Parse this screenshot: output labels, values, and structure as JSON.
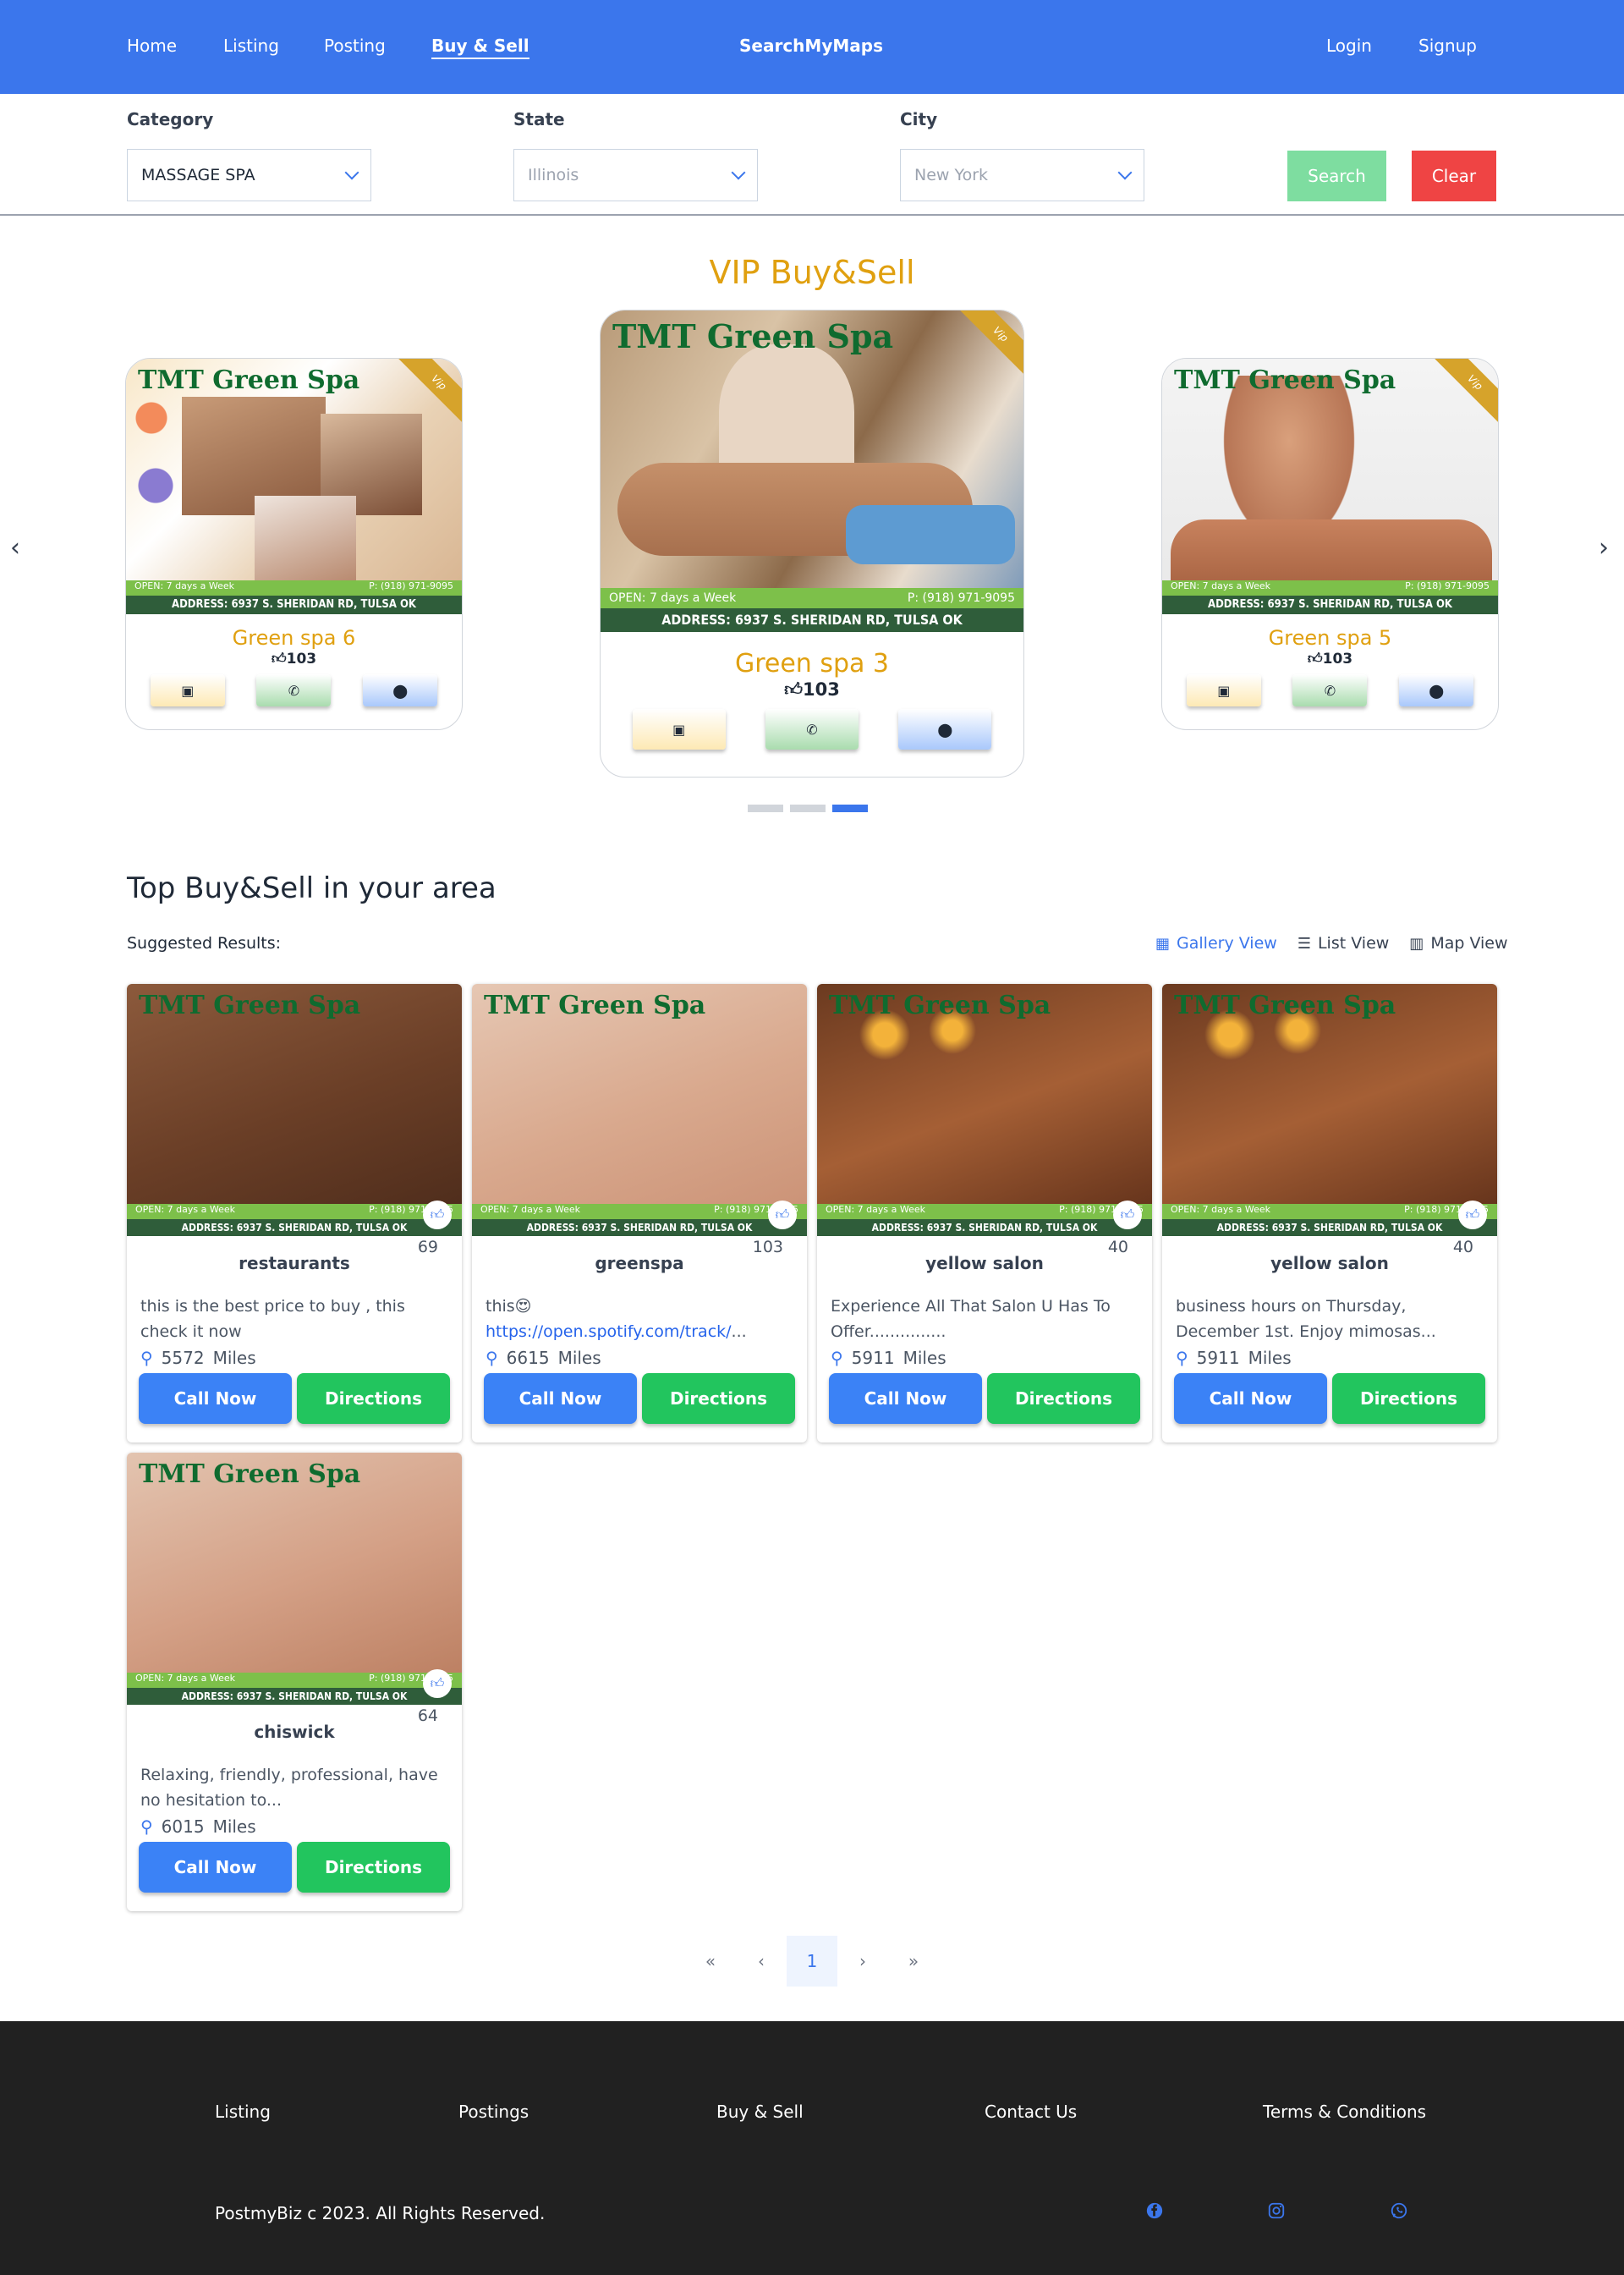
{
  "nav": {
    "links": [
      "Home",
      "Listing",
      "Posting",
      "Buy & Sell"
    ],
    "brand": "SearchMyMaps",
    "login": "Login",
    "signup": "Signup"
  },
  "filters": {
    "category_label": "Category",
    "category_value": "MASSAGE SPA",
    "state_label": "State",
    "state_value": "Illinois",
    "city_label": "City",
    "city_value": "New York",
    "search": "Search",
    "clear": "Clear"
  },
  "vip": {
    "title": "VIP Buy&Sell",
    "ribbon": "Vip",
    "cards": [
      {
        "name": "Green spa 6",
        "likes": "103"
      },
      {
        "name": "Green spa 3",
        "likes": "103"
      },
      {
        "name": "Green spa 5",
        "likes": "103"
      }
    ],
    "active_slide": 3,
    "slide_count": 3
  },
  "ad": {
    "brand": "TMT Green Spa",
    "open": "OPEN: 7 days a Week",
    "phone": "P: (918) 971-9095",
    "address": "ADDRESS: 6937 S. SHERIDAN RD, TULSA OK"
  },
  "top": {
    "title": "Top Buy&Sell in your area",
    "suggested": "Suggested Results:",
    "views": [
      "Gallery View",
      "List View",
      "Map View"
    ],
    "call": "Call Now",
    "directions": "Directions",
    "miles_unit": "Miles",
    "listings": [
      {
        "title": "restaurants",
        "count": "69",
        "desc": "this is the best price to buy , this check it now",
        "miles": "5572"
      },
      {
        "title": "greenspa",
        "count": "103",
        "desc_prefix": "this",
        "emoji": "😍",
        "link": "https://open.spotify.com/track/",
        "link_suffix": "...",
        "miles": "6615"
      },
      {
        "title": "yellow salon",
        "count": "40",
        "desc": "Experience All That Salon U Has To Offer...............",
        "miles": "5911"
      },
      {
        "title": "yellow salon",
        "count": "40",
        "desc": "business hours on Thursday, December 1st. Enjoy mimosas...",
        "miles": "5911"
      },
      {
        "title": "chiswick",
        "count": "64",
        "desc": "Relaxing, friendly, professional, have no hesitation to...",
        "miles": "6015"
      }
    ]
  },
  "pagination": {
    "first": "«",
    "prev": "‹",
    "current": "1",
    "next": "›",
    "last": "»"
  },
  "footer": {
    "links": [
      "Listing",
      "Postings",
      "Buy & Sell",
      "Contact Us",
      "Terms & Conditions"
    ],
    "copyright": "PostmyBiz c 2023. All Rights Reserved.",
    "social": [
      "facebook-icon",
      "instagram-icon",
      "whatsapp-icon"
    ],
    "social_color": "#3b76ec"
  },
  "colors": {
    "nav": "#3b76ec",
    "vip_gold": "#e0a010",
    "call": "#3b82f6",
    "directions": "#22c55e",
    "clear": "#ef4444",
    "search": "#7edda0",
    "footer": "#212121"
  }
}
